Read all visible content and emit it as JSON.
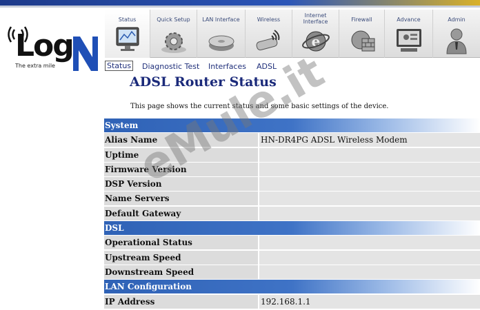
{
  "logo": {
    "word": "Log",
    "tagline": "The extra mile"
  },
  "nav": {
    "tabs": [
      {
        "label": "Status",
        "icon": "monitor-icon"
      },
      {
        "label": "Quick Setup",
        "icon": "gear-icon"
      },
      {
        "label": "LAN Interface",
        "icon": "hard-drive-icon"
      },
      {
        "label": "Wireless",
        "icon": "wireless-adapter-icon"
      },
      {
        "label": "Internet Interface",
        "icon": "internet-explorer-icon"
      },
      {
        "label": "Firewall",
        "icon": "firewall-icon"
      },
      {
        "label": "Advance",
        "icon": "advance-monitor-icon"
      },
      {
        "label": "Admin",
        "icon": "admin-user-icon"
      }
    ]
  },
  "subnav": {
    "items": [
      "Status",
      "Diagnostic Test",
      "Interfaces",
      "ADSL"
    ]
  },
  "page": {
    "title": "ADSL Router Status",
    "description": "This page shows the current status and some basic settings of the device."
  },
  "sections": [
    {
      "title": "System",
      "rows": [
        {
          "label": "Alias Name",
          "value": "HN-DR4PG ADSL Wireless Modem"
        },
        {
          "label": "Uptime",
          "value": ""
        },
        {
          "label": "Firmware Version",
          "value": ""
        },
        {
          "label": "DSP Version",
          "value": ""
        },
        {
          "label": "Name Servers",
          "value": ""
        },
        {
          "label": "Default Gateway",
          "value": ""
        }
      ]
    },
    {
      "title": "DSL",
      "rows": [
        {
          "label": "Operational Status",
          "value": ""
        },
        {
          "label": "Upstream Speed",
          "value": ""
        },
        {
          "label": "Downstream Speed",
          "value": ""
        }
      ]
    },
    {
      "title": "LAN Configuration",
      "rows": [
        {
          "label": "IP Address",
          "value": "192.168.1.1"
        }
      ]
    }
  ],
  "watermark": "eMule.it",
  "colors": {
    "section_blue": "#2f62b6",
    "title_blue": "#1b2a7a"
  }
}
